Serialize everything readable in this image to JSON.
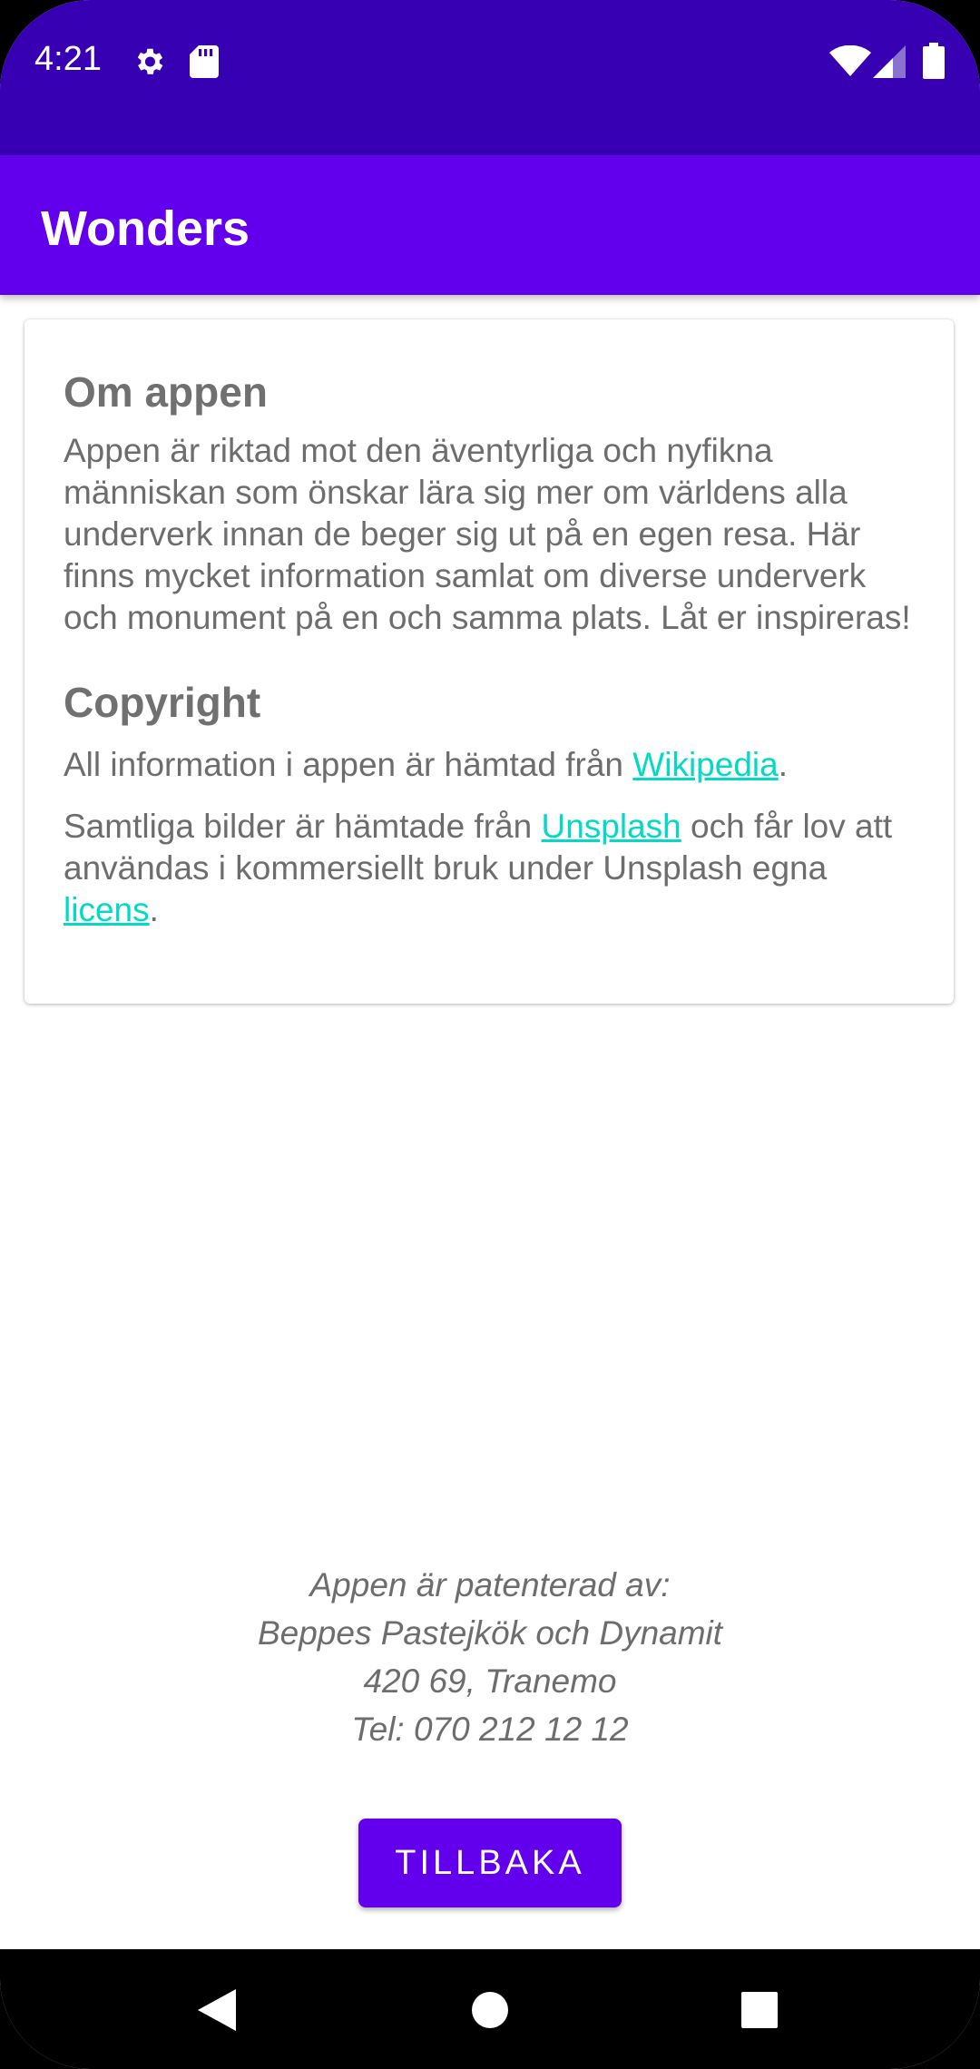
{
  "status_bar": {
    "time": "4:21",
    "icons": [
      "settings-icon",
      "sd-card-icon",
      "wifi-icon",
      "signal-icon",
      "battery-icon"
    ]
  },
  "app_bar": {
    "title": "Wonders"
  },
  "about": {
    "heading": "Om appen",
    "text": "Appen är riktad mot den äventyrliga och nyfikna människan som önskar lära sig mer om världens alla underverk innan de beger sig ut på en egen resa. Här finns mycket information samlat om diverse underverk och monument på en och samma plats. Låt er inspireras!"
  },
  "copyright": {
    "heading": "Copyright",
    "info_prefix": "All information i appen är hämtad från ",
    "info_link": "Wikipedia",
    "info_suffix": ".",
    "images_prefix": "Samtliga bilder är hämtade från ",
    "images_link": "Unsplash",
    "images_middle": " och får lov att användas i kommersiellt bruk under Unsplash egna ",
    "license_link": "licens",
    "images_suffix": "."
  },
  "footer": {
    "line1": "Appen är patenterad av:",
    "line2": "Beppes Pastejkök och Dynamit",
    "line3": "420 69, Tranemo",
    "line4": "Tel: 070 212 12 12"
  },
  "back_button": {
    "label": "TILLBAKA"
  },
  "nav_bar": {
    "icons": [
      "back-triangle-icon",
      "home-circle-icon",
      "recents-square-icon"
    ]
  },
  "colors": {
    "status_bar": "#3700b3",
    "primary": "#6200ee",
    "link": "#03dac5",
    "text": "#6d6d6d"
  }
}
